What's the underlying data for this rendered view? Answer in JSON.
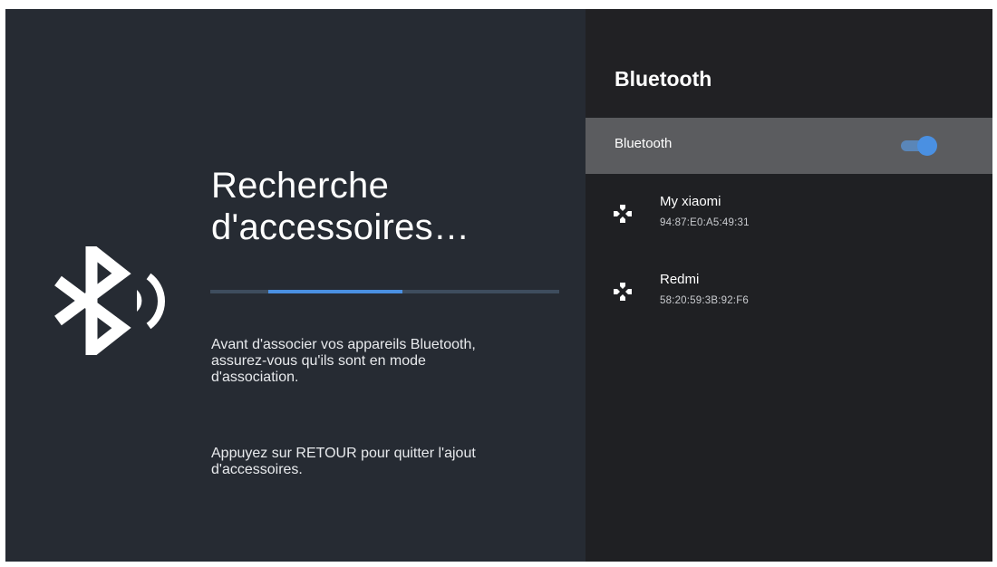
{
  "left_panel": {
    "title_line1": "Recherche",
    "title_line2": "d'accessoires…",
    "progress": {
      "start_fraction": 0.165,
      "end_fraction": 0.55
    },
    "description_line1": "Avant d'associer vos appareils Bluetooth,",
    "description_line2": "assurez-vous qu'ils sont en mode",
    "description_line3": "d'association.",
    "hint_line1": "Appuyez sur RETOUR pour quitter l'ajout",
    "hint_line2": "d'accessoires.",
    "icon": "bluetooth-searching-icon"
  },
  "right_panel": {
    "title": "Bluetooth",
    "toggle": {
      "label": "Bluetooth",
      "state": "on"
    },
    "devices": [
      {
        "name": "My xiaomi",
        "address": "94:87:E0:A5:49:31",
        "icon": "gamepad-icon"
      },
      {
        "name": "Redmi",
        "address": "58:20:59:3B:92:F6",
        "icon": "gamepad-icon"
      }
    ]
  },
  "colors": {
    "left_bg": "#262b33",
    "right_bg": "#1f2023",
    "highlight_row": "#5b5c5f",
    "accent": "#4a90e2"
  }
}
